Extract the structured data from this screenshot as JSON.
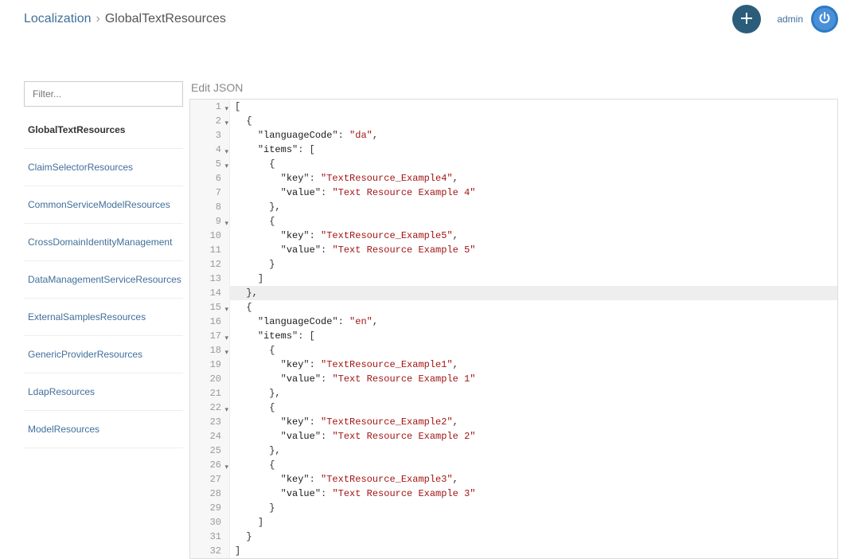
{
  "header": {
    "breadcrumb_parent": "Localization",
    "breadcrumb_sep": "›",
    "breadcrumb_current": "GlobalTextResources",
    "user": "admin"
  },
  "sidebar": {
    "filter_placeholder": "Filter...",
    "items": [
      {
        "label": "GlobalTextResources",
        "active": true
      },
      {
        "label": "ClaimSelectorResources",
        "active": false
      },
      {
        "label": "CommonServiceModelResources",
        "active": false
      },
      {
        "label": "CrossDomainIdentityManagement",
        "active": false
      },
      {
        "label": "DataManagementServiceResources",
        "active": false
      },
      {
        "label": "ExternalSamplesResources",
        "active": false
      },
      {
        "label": "GenericProviderResources",
        "active": false
      },
      {
        "label": "LdapResources",
        "active": false
      },
      {
        "label": "ModelResources",
        "active": false
      }
    ]
  },
  "editor": {
    "label": "Edit JSON",
    "highlight_line": 14,
    "lines": [
      {
        "n": 1,
        "fold": true,
        "indent": 0,
        "tokens": [
          {
            "t": "punc",
            "v": "["
          }
        ]
      },
      {
        "n": 2,
        "fold": true,
        "indent": 1,
        "tokens": [
          {
            "t": "punc",
            "v": "{"
          }
        ]
      },
      {
        "n": 3,
        "fold": false,
        "indent": 2,
        "tokens": [
          {
            "t": "key",
            "v": "languageCode"
          },
          {
            "t": "punc",
            "v": ": "
          },
          {
            "t": "str",
            "v": "da"
          },
          {
            "t": "punc",
            "v": ","
          }
        ]
      },
      {
        "n": 4,
        "fold": true,
        "indent": 2,
        "tokens": [
          {
            "t": "key",
            "v": "items"
          },
          {
            "t": "punc",
            "v": ": ["
          }
        ]
      },
      {
        "n": 5,
        "fold": true,
        "indent": 3,
        "tokens": [
          {
            "t": "punc",
            "v": "{"
          }
        ]
      },
      {
        "n": 6,
        "fold": false,
        "indent": 4,
        "tokens": [
          {
            "t": "key",
            "v": "key"
          },
          {
            "t": "punc",
            "v": ": "
          },
          {
            "t": "str",
            "v": "TextResource_Example4"
          },
          {
            "t": "punc",
            "v": ","
          }
        ]
      },
      {
        "n": 7,
        "fold": false,
        "indent": 4,
        "tokens": [
          {
            "t": "key",
            "v": "value"
          },
          {
            "t": "punc",
            "v": ": "
          },
          {
            "t": "str",
            "v": "Text Resource Example 4"
          }
        ]
      },
      {
        "n": 8,
        "fold": false,
        "indent": 3,
        "tokens": [
          {
            "t": "punc",
            "v": "},"
          }
        ]
      },
      {
        "n": 9,
        "fold": true,
        "indent": 3,
        "tokens": [
          {
            "t": "punc",
            "v": "{"
          }
        ]
      },
      {
        "n": 10,
        "fold": false,
        "indent": 4,
        "tokens": [
          {
            "t": "key",
            "v": "key"
          },
          {
            "t": "punc",
            "v": ": "
          },
          {
            "t": "str",
            "v": "TextResource_Example5"
          },
          {
            "t": "punc",
            "v": ","
          }
        ]
      },
      {
        "n": 11,
        "fold": false,
        "indent": 4,
        "tokens": [
          {
            "t": "key",
            "v": "value"
          },
          {
            "t": "punc",
            "v": ": "
          },
          {
            "t": "str",
            "v": "Text Resource Example 5"
          }
        ]
      },
      {
        "n": 12,
        "fold": false,
        "indent": 3,
        "tokens": [
          {
            "t": "punc",
            "v": "}"
          }
        ]
      },
      {
        "n": 13,
        "fold": false,
        "indent": 2,
        "tokens": [
          {
            "t": "punc",
            "v": "]"
          }
        ]
      },
      {
        "n": 14,
        "fold": false,
        "indent": 1,
        "tokens": [
          {
            "t": "punc",
            "v": "},"
          }
        ]
      },
      {
        "n": 15,
        "fold": true,
        "indent": 1,
        "tokens": [
          {
            "t": "punc",
            "v": "{"
          }
        ]
      },
      {
        "n": 16,
        "fold": false,
        "indent": 2,
        "tokens": [
          {
            "t": "key",
            "v": "languageCode"
          },
          {
            "t": "punc",
            "v": ": "
          },
          {
            "t": "str",
            "v": "en"
          },
          {
            "t": "punc",
            "v": ","
          }
        ]
      },
      {
        "n": 17,
        "fold": true,
        "indent": 2,
        "tokens": [
          {
            "t": "key",
            "v": "items"
          },
          {
            "t": "punc",
            "v": ": ["
          }
        ]
      },
      {
        "n": 18,
        "fold": true,
        "indent": 3,
        "tokens": [
          {
            "t": "punc",
            "v": "{"
          }
        ]
      },
      {
        "n": 19,
        "fold": false,
        "indent": 4,
        "tokens": [
          {
            "t": "key",
            "v": "key"
          },
          {
            "t": "punc",
            "v": ": "
          },
          {
            "t": "str",
            "v": "TextResource_Example1"
          },
          {
            "t": "punc",
            "v": ","
          }
        ]
      },
      {
        "n": 20,
        "fold": false,
        "indent": 4,
        "tokens": [
          {
            "t": "key",
            "v": "value"
          },
          {
            "t": "punc",
            "v": ": "
          },
          {
            "t": "str",
            "v": "Text Resource Example 1"
          }
        ]
      },
      {
        "n": 21,
        "fold": false,
        "indent": 3,
        "tokens": [
          {
            "t": "punc",
            "v": "},"
          }
        ]
      },
      {
        "n": 22,
        "fold": true,
        "indent": 3,
        "tokens": [
          {
            "t": "punc",
            "v": "{"
          }
        ]
      },
      {
        "n": 23,
        "fold": false,
        "indent": 4,
        "tokens": [
          {
            "t": "key",
            "v": "key"
          },
          {
            "t": "punc",
            "v": ": "
          },
          {
            "t": "str",
            "v": "TextResource_Example2"
          },
          {
            "t": "punc",
            "v": ","
          }
        ]
      },
      {
        "n": 24,
        "fold": false,
        "indent": 4,
        "tokens": [
          {
            "t": "key",
            "v": "value"
          },
          {
            "t": "punc",
            "v": ": "
          },
          {
            "t": "str",
            "v": "Text Resource Example 2"
          }
        ]
      },
      {
        "n": 25,
        "fold": false,
        "indent": 3,
        "tokens": [
          {
            "t": "punc",
            "v": "},"
          }
        ]
      },
      {
        "n": 26,
        "fold": true,
        "indent": 3,
        "tokens": [
          {
            "t": "punc",
            "v": "{"
          }
        ]
      },
      {
        "n": 27,
        "fold": false,
        "indent": 4,
        "tokens": [
          {
            "t": "key",
            "v": "key"
          },
          {
            "t": "punc",
            "v": ": "
          },
          {
            "t": "str",
            "v": "TextResource_Example3"
          },
          {
            "t": "punc",
            "v": ","
          }
        ]
      },
      {
        "n": 28,
        "fold": false,
        "indent": 4,
        "tokens": [
          {
            "t": "key",
            "v": "value"
          },
          {
            "t": "punc",
            "v": ": "
          },
          {
            "t": "str",
            "v": "Text Resource Example 3"
          }
        ]
      },
      {
        "n": 29,
        "fold": false,
        "indent": 3,
        "tokens": [
          {
            "t": "punc",
            "v": "}"
          }
        ]
      },
      {
        "n": 30,
        "fold": false,
        "indent": 2,
        "tokens": [
          {
            "t": "punc",
            "v": "]"
          }
        ]
      },
      {
        "n": 31,
        "fold": false,
        "indent": 1,
        "tokens": [
          {
            "t": "punc",
            "v": "}"
          }
        ]
      },
      {
        "n": 32,
        "fold": false,
        "indent": 0,
        "tokens": [
          {
            "t": "punc",
            "v": "]"
          }
        ]
      }
    ]
  }
}
